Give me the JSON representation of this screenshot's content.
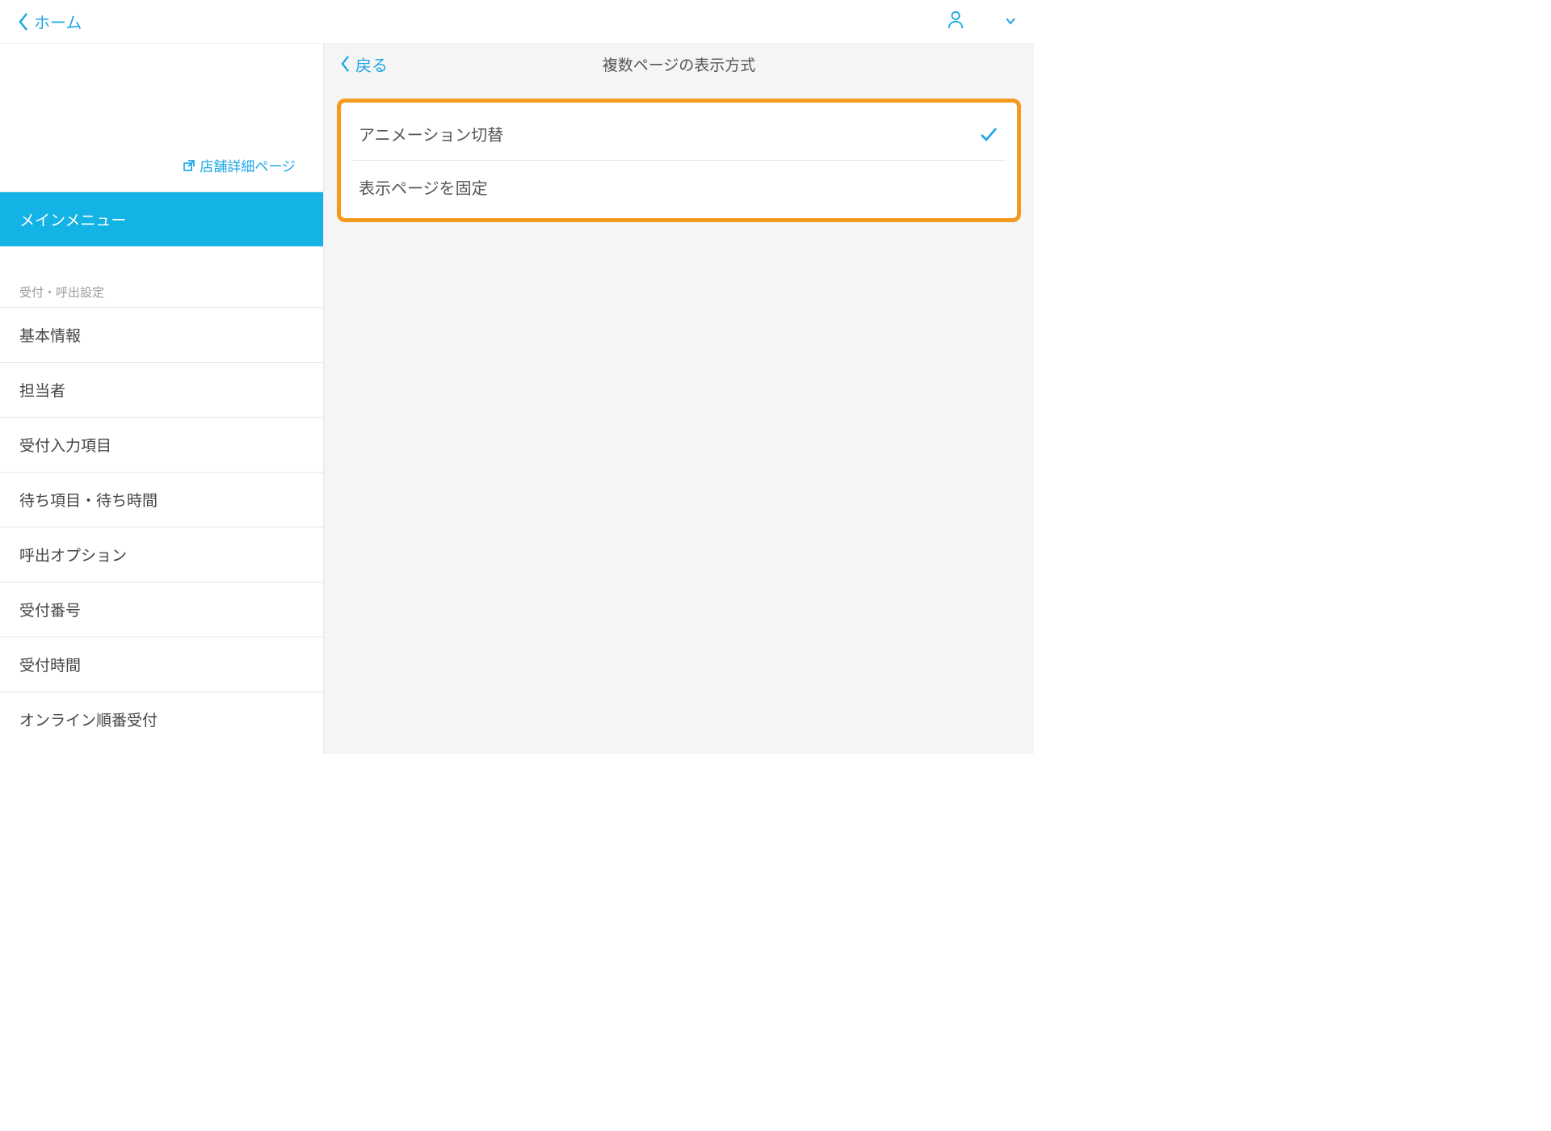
{
  "topbar": {
    "home_label": "ホーム"
  },
  "sidebar": {
    "detail_link_label": "店舗詳細ページ",
    "main_menu_label": "メインメニュー",
    "section_label": "受付・呼出設定",
    "items": [
      "基本情報",
      "担当者",
      "受付入力項目",
      "待ち項目・待ち時間",
      "呼出オプション",
      "受付番号",
      "受付時間",
      "オンライン順番受付"
    ]
  },
  "main": {
    "back_label": "戻る",
    "title": "複数ページの表示方式",
    "options": [
      {
        "label": "アニメーション切替",
        "selected": true
      },
      {
        "label": "表示ページを固定",
        "selected": false
      }
    ]
  }
}
